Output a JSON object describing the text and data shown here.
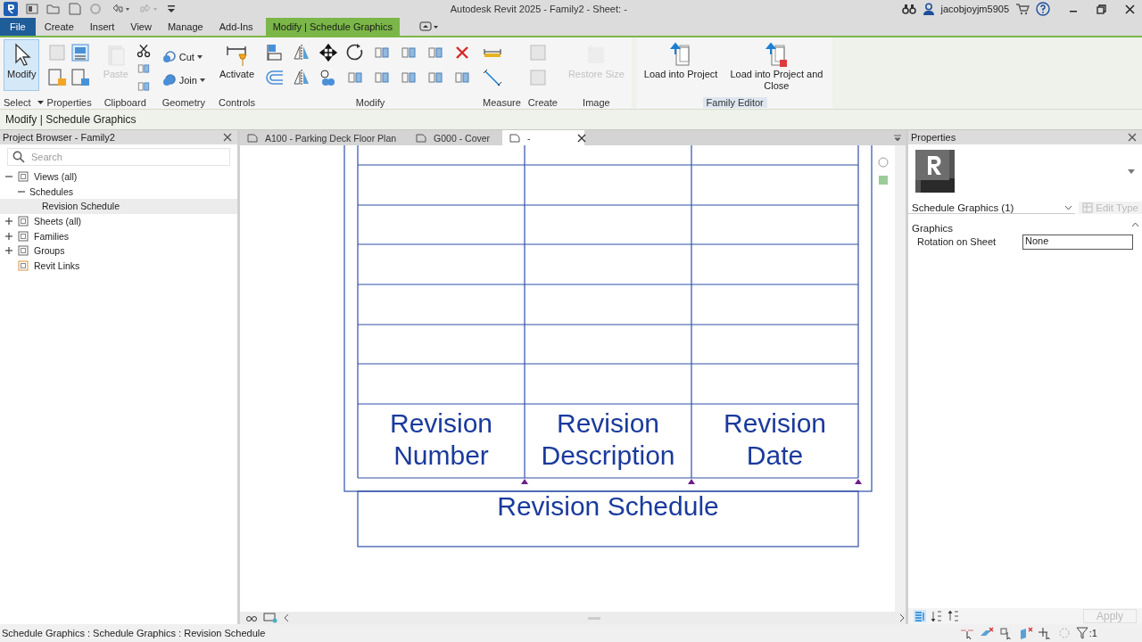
{
  "window": {
    "title": "Autodesk Revit 2025 - Family2 - Sheet: -",
    "user": "jacobjoyjm5905"
  },
  "menu_tabs": [
    {
      "label": "File",
      "kind": "file",
      "selected": false
    },
    {
      "label": "Create",
      "kind": "tab",
      "selected": false
    },
    {
      "label": "Insert",
      "kind": "tab",
      "selected": false
    },
    {
      "label": "View",
      "kind": "tab",
      "selected": false
    },
    {
      "label": "Manage",
      "kind": "tab",
      "selected": false
    },
    {
      "label": "Add-Ins",
      "kind": "tab",
      "selected": false
    },
    {
      "label": "Modify | Schedule Graphics",
      "kind": "context",
      "selected": true
    }
  ],
  "ribbon": {
    "panels": [
      {
        "label": "Select",
        "dropdown": true,
        "buttons": [
          {
            "kind": "large",
            "label": "Modify",
            "selected": true,
            "disabled": false
          }
        ]
      },
      {
        "label": "Properties",
        "dropdown": false
      },
      {
        "label": "Clipboard",
        "dropdown": false,
        "buttons": [
          {
            "kind": "large",
            "label": "Paste",
            "selected": false,
            "disabled": true
          }
        ]
      },
      {
        "label": "Geometry",
        "dropdown": false,
        "buttons": [
          {
            "kind": "small",
            "label": "Cut",
            "selected": false,
            "disabled": false
          },
          {
            "kind": "small",
            "label": "Join",
            "selected": false,
            "disabled": false
          }
        ]
      },
      {
        "label": "Controls",
        "dropdown": false,
        "buttons": [
          {
            "kind": "large",
            "label": "Activate",
            "selected": false,
            "disabled": false
          }
        ]
      },
      {
        "label": "Modify",
        "dropdown": false
      },
      {
        "label": "Measure",
        "dropdown": false
      },
      {
        "label": "Create",
        "dropdown": false
      },
      {
        "label": "Image",
        "dropdown": false,
        "buttons": [
          {
            "kind": "large",
            "label": "Restore Size",
            "selected": false,
            "disabled": true
          }
        ]
      },
      {
        "label": "Family Editor",
        "dropdown": false,
        "buttons": [
          {
            "kind": "large",
            "label": "Load into Project",
            "selected": false,
            "disabled": false
          },
          {
            "kind": "large",
            "label": "Load into Project and Close",
            "selected": false,
            "disabled": false
          }
        ]
      }
    ]
  },
  "options_bar": "Modify | Schedule Graphics",
  "project_browser": {
    "title": "Project Browser - Family2",
    "search": {
      "placeholder": "Search"
    },
    "tree": [
      {
        "label": "Views (all)",
        "expanded": true,
        "selected": false,
        "children": [
          {
            "label": "Schedules",
            "expanded": true,
            "selected": false,
            "children": [
              {
                "label": "Revision Schedule",
                "selected": true
              }
            ]
          }
        ]
      },
      {
        "label": "Sheets (all)",
        "expanded": false,
        "selected": false
      },
      {
        "label": "Families",
        "expanded": false,
        "selected": false
      },
      {
        "label": "Groups",
        "expanded": false,
        "selected": false
      },
      {
        "label": "Revit Links",
        "selected": false
      }
    ]
  },
  "view_tabs": [
    {
      "label": "A100 - Parking Deck Floor Plan",
      "selected": false
    },
    {
      "label": "G000 - Cover",
      "selected": false
    },
    {
      "label": "-",
      "selected": true
    }
  ],
  "schedule": {
    "headers": [
      [
        "Revision",
        "Number"
      ],
      [
        "Revision",
        "Description"
      ],
      [
        "Revision",
        "Date"
      ]
    ],
    "title": "Revision Schedule"
  },
  "properties": {
    "title": "Properties",
    "type_selector": "Schedule Graphics (1)",
    "edit_type": {
      "label": "Edit Type",
      "disabled": true
    },
    "sections": [
      {
        "label": "Graphics",
        "rows": [
          {
            "name": "Rotation on Sheet",
            "value": "None"
          }
        ]
      }
    ],
    "apply": {
      "label": "Apply",
      "disabled": true
    }
  },
  "status_bar": {
    "text": "Schedule Graphics : Schedule Graphics : Revision Schedule",
    "filter_count": ":1"
  }
}
